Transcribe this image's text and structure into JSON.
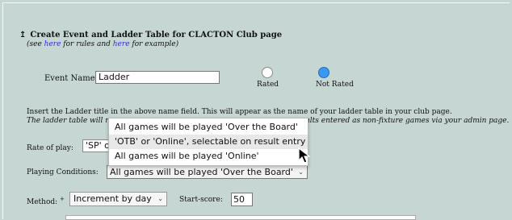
{
  "heading": {
    "arrow": "↥",
    "text": "Create Event and Ladder Table for CLACTON Club page",
    "note_see": "(see ",
    "note_link1": "here",
    "note_mid": " for rules and ",
    "note_link2": "here",
    "note_end": " for example)"
  },
  "event": {
    "label": "Event Name:",
    "value": "Ladder"
  },
  "rating": {
    "selected": "Not Rated",
    "options": [
      "Rated",
      "Not Rated"
    ]
  },
  "info": {
    "line1": "Insert the Ladder title in the above name field. This will appear as the name of your ladder table in your club page.",
    "line2_start": "The ladder table will n",
    "line2_end": "ults entered as non-fixture games via your admin page."
  },
  "rate": {
    "label": "Rate of play:",
    "value": "'SP' o"
  },
  "conditions": {
    "label": "Playing Conditions:",
    "value": "All games will be played 'Over the Board'",
    "options": [
      "All games will be played 'Over the Board'",
      "'OTB' or 'Online', selectable on result entry",
      "All games will be played 'Online'"
    ],
    "highlighted_index": 1
  },
  "method": {
    "label": "Method:",
    "marker": "+",
    "value": "Increment by day"
  },
  "start": {
    "label": "Start-score:",
    "value": "50"
  }
}
